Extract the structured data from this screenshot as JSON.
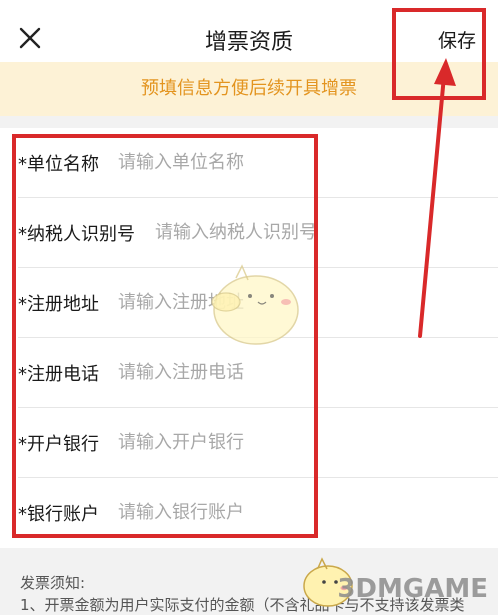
{
  "header": {
    "title": "增票资质",
    "save_label": "保存",
    "close_icon": "close-icon"
  },
  "notice": {
    "text": "预填信息方便后续开具增票"
  },
  "form": {
    "fields": [
      {
        "label": "*单位名称",
        "placeholder": "请输入单位名称",
        "value": ""
      },
      {
        "label": "*纳税人识别号",
        "placeholder": "请输入纳税人识别号",
        "value": ""
      },
      {
        "label": "*注册地址",
        "placeholder": "请输入注册地址",
        "value": ""
      },
      {
        "label": "*注册电话",
        "placeholder": "请输入注册电话",
        "value": ""
      },
      {
        "label": "*开户银行",
        "placeholder": "请输入开户银行",
        "value": ""
      },
      {
        "label": "*银行账户",
        "placeholder": "请输入银行账户",
        "value": ""
      }
    ]
  },
  "tips": {
    "title": "发票须知:",
    "line1": "1、开票金额为用户实际支付的金额（不含礼品卡与不支持该发票类"
  },
  "watermark": {
    "text": "3DMGAME"
  },
  "colors": {
    "notice_bg": "#fdf2d6",
    "notice_text": "#e3941f",
    "annotation_red": "#d9292a"
  }
}
